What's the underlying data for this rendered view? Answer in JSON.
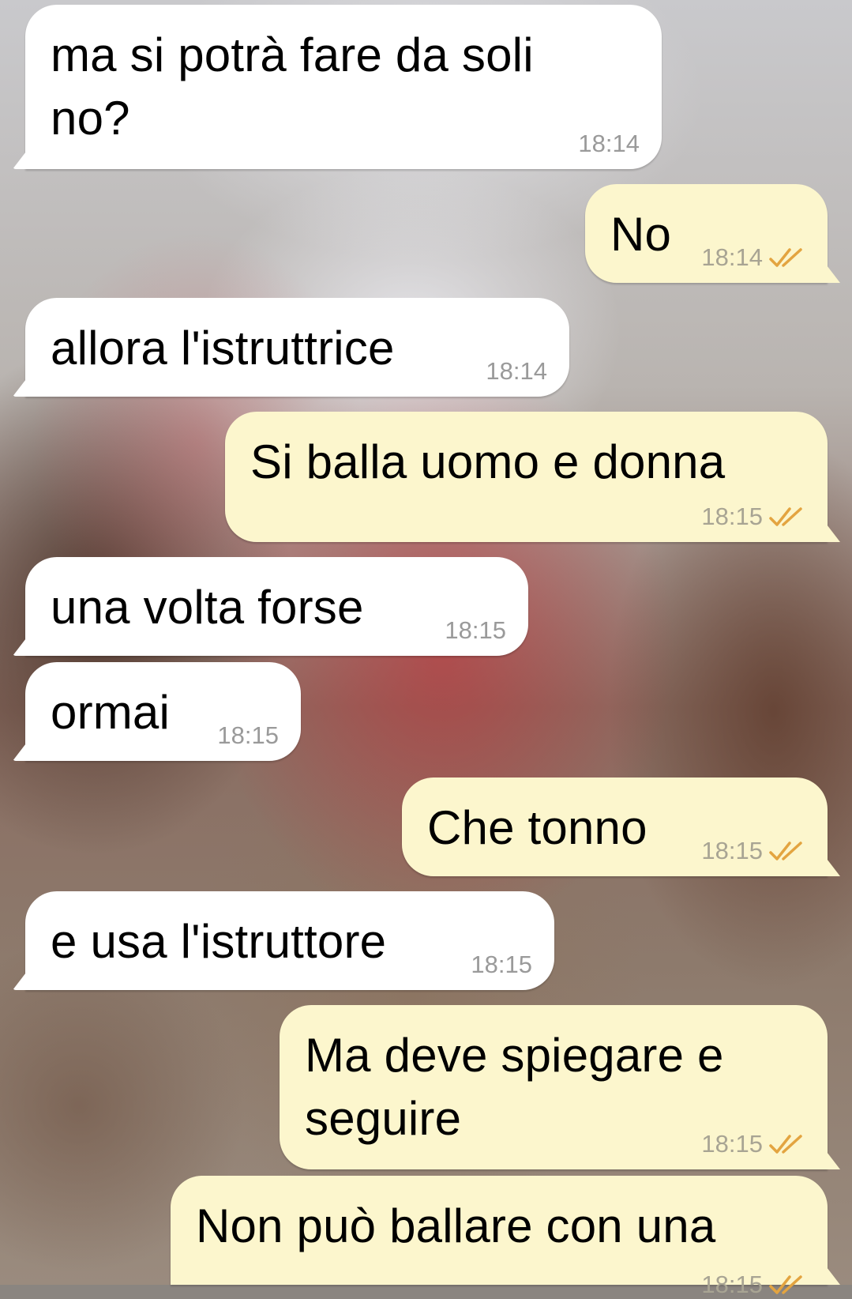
{
  "colors": {
    "incoming_bubble": "#ffffff",
    "outgoing_bubble": "#fcf6cd",
    "timestamp_gray": "#9a9a9a",
    "read_ticks": "#e3a440"
  },
  "icons": {
    "read_receipt": "double-check-icon"
  },
  "messages": [
    {
      "direction": "incoming",
      "lines": [
        "ma si potrà fare da soli",
        "no?"
      ],
      "time": "18:14"
    },
    {
      "direction": "outgoing",
      "lines": [
        "No"
      ],
      "time": "18:14",
      "status": "read"
    },
    {
      "direction": "incoming",
      "lines": [
        "allora l'istruttrice"
      ],
      "time": "18:14"
    },
    {
      "direction": "outgoing",
      "lines": [
        "Si balla uomo e donna"
      ],
      "time": "18:15",
      "status": "read"
    },
    {
      "direction": "incoming",
      "lines": [
        "una volta forse"
      ],
      "time": "18:15"
    },
    {
      "direction": "incoming",
      "lines": [
        "ormai"
      ],
      "time": "18:15"
    },
    {
      "direction": "outgoing",
      "lines": [
        "Che tonno"
      ],
      "time": "18:15",
      "status": "read"
    },
    {
      "direction": "incoming",
      "lines": [
        "e usa l'istruttore"
      ],
      "time": "18:15"
    },
    {
      "direction": "outgoing",
      "lines": [
        "Ma deve spiegare e",
        "seguire"
      ],
      "time": "18:15",
      "status": "read"
    },
    {
      "direction": "outgoing",
      "lines": [
        "Non può ballare con una"
      ],
      "time": "18:15",
      "status": "read"
    }
  ]
}
